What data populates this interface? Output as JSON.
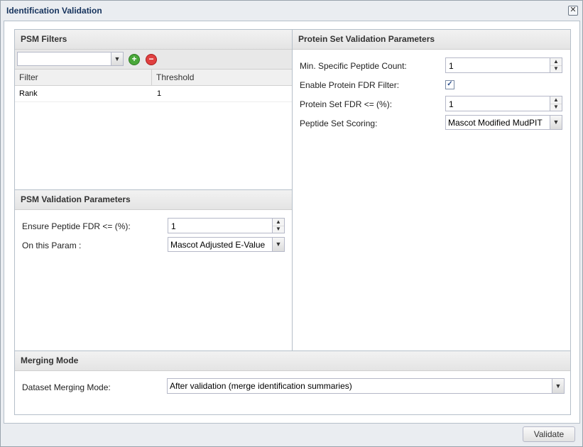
{
  "window": {
    "title": "Identification Validation",
    "close_icon": "close-icon"
  },
  "psm_filters": {
    "header": "PSM Filters",
    "filter_select_value": "",
    "add_icon": "add-icon",
    "remove_icon": "remove-icon",
    "columns": [
      "Filter",
      "Threshold"
    ],
    "rows": [
      {
        "filter": "Rank",
        "threshold": "1"
      }
    ]
  },
  "psm_validation": {
    "header": "PSM Validation Parameters",
    "fdr_label": "Ensure Peptide FDR <= (%):",
    "fdr_value": "1",
    "param_label": "On this Param :",
    "param_value": "Mascot Adjusted E-Value"
  },
  "protein_set": {
    "header": "Protein Set Validation Parameters",
    "min_peptide_label": "Min. Specific Peptide Count:",
    "min_peptide_value": "1",
    "enable_fdr_label": "Enable Protein FDR Filter:",
    "enable_fdr_checked": true,
    "fdr_label": "Protein Set FDR <= (%):",
    "fdr_value": "1",
    "scoring_label": "Peptide Set Scoring:",
    "scoring_value": "Mascot Modified MudPIT"
  },
  "merging": {
    "header": "Merging Mode",
    "label": "Dataset Merging Mode:",
    "value": "After validation (merge identification summaries)"
  },
  "footer": {
    "validate_label": "Validate"
  }
}
